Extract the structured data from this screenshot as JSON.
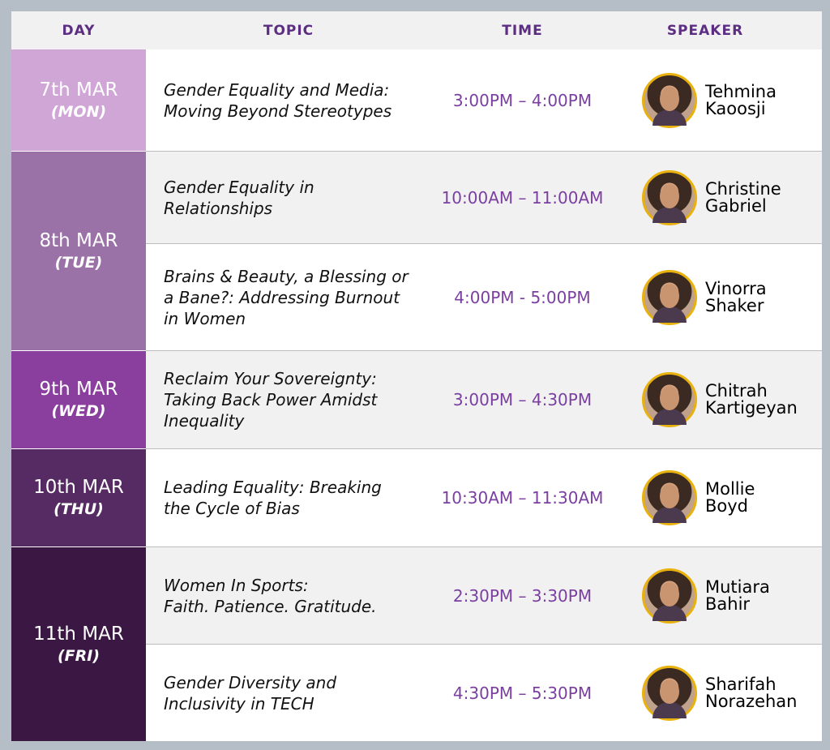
{
  "header": {
    "day": "DAY",
    "topic": "TOPIC",
    "time": "TIME",
    "speaker": "SPEAKER"
  },
  "days": [
    {
      "date": "7th MAR",
      "weekday": "(MON)",
      "color": "#cfa6d6"
    },
    {
      "date": "8th MAR",
      "weekday": "(TUE)",
      "color": "#9a72a7"
    },
    {
      "date": "9th MAR",
      "weekday": "(WED)",
      "color": "#8a3f9e"
    },
    {
      "date": "10th MAR",
      "weekday": "(THU)",
      "color": "#562a63"
    },
    {
      "date": "11th MAR",
      "weekday": "(FRI)",
      "color": "#3b1844"
    }
  ],
  "sessions": [
    {
      "topic_l1": "Gender Equality and Media:",
      "topic_l2": "Moving Beyond Stereotypes",
      "topic_l3": "",
      "time": "3:00PM – 4:00PM",
      "speaker_first": "Tehmina",
      "speaker_last": "Kaoosji"
    },
    {
      "topic_l1": "Gender Equality in",
      "topic_l2": "Relationships",
      "topic_l3": "",
      "time": "10:00AM – 11:00AM",
      "speaker_first": "Christine",
      "speaker_last": "Gabriel"
    },
    {
      "topic_l1": "Brains & Beauty, a Blessing or",
      "topic_l2": "a Bane?: Addressing Burnout",
      "topic_l3": "in Women",
      "time": "4:00PM - 5:00PM",
      "speaker_first": "Vinorra",
      "speaker_last": "Shaker"
    },
    {
      "topic_l1": "Reclaim Your Sovereignty:",
      "topic_l2": "Taking Back Power Amidst",
      "topic_l3": "Inequality",
      "time": "3:00PM – 4:30PM",
      "speaker_first": "Chitrah",
      "speaker_last": "Kartigeyan"
    },
    {
      "topic_l1": "Leading Equality: Breaking",
      "topic_l2": "the Cycle of Bias",
      "topic_l3": "",
      "time": "10:30AM – 11:30AM",
      "speaker_first": "Mollie",
      "speaker_last": "Boyd"
    },
    {
      "topic_l1": "Women In Sports:",
      "topic_l2": "Faith. Patience. Gratitude.",
      "topic_l3": "",
      "time": "2:30PM – 3:30PM",
      "speaker_first": "Mutiara",
      "speaker_last": "Bahir"
    },
    {
      "topic_l1": "Gender Diversity and",
      "topic_l2": "Inclusivity in TECH",
      "topic_l3": "",
      "time": "4:30PM – 5:30PM",
      "speaker_first": "Sharifah",
      "speaker_last": "Norazehan"
    }
  ]
}
